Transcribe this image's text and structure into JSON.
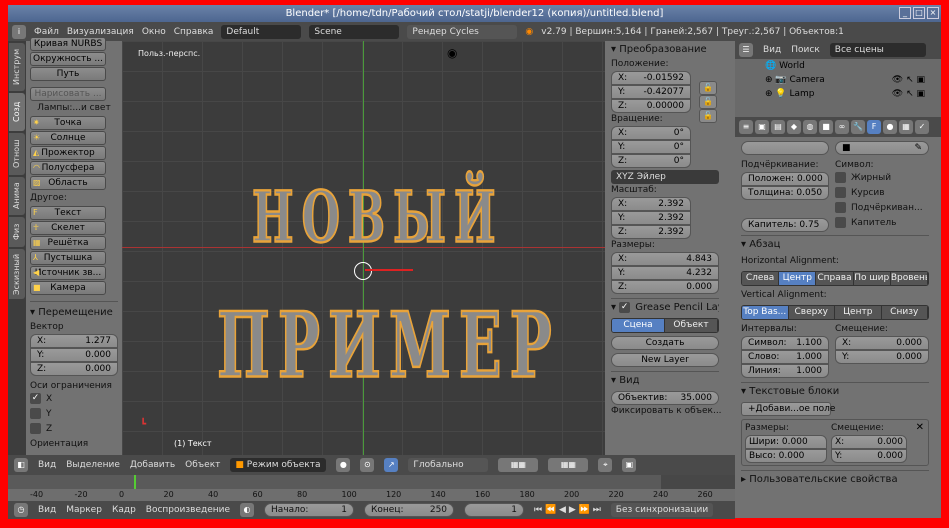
{
  "window": {
    "title": "Blender* [/home/tdn/Рабочий стол/statji/blender12 (копия)/untitled.blend]"
  },
  "menubar": {
    "items": [
      "Файл",
      "Визуализация",
      "Окно",
      "Справка"
    ],
    "layout": "Default",
    "scene": "Scene",
    "engine": "Рендер Cycles",
    "stats": "v2.79 | Вершин:5,164 | Граней:2,567 | Треуг.:2,567 | Объектов:1"
  },
  "tooltabs": [
    "Инструм",
    "Созд",
    "Отнош",
    "Анима",
    "Физ",
    "Эскизный ка"
  ],
  "toolshelf": {
    "curve_items": [
      "Кривая NURBS",
      "Окружность ...",
      "Путь"
    ],
    "draw": "Нарисовать ...",
    "lamps_label": "Лампы:...и свет",
    "lamps": [
      "Точка",
      "Солнце",
      "Прожектор",
      "Полусфера",
      "Область"
    ],
    "other_label": "Другое:",
    "other": [
      "Текст",
      "Скелет",
      "Решётка",
      "Пустышка",
      "Источник зв...",
      "Камера"
    ]
  },
  "operator": {
    "title": "Перемещение",
    "vector_label": "Вектор",
    "vector": [
      {
        "axis": "X:",
        "value": "1.277"
      },
      {
        "axis": "Y:",
        "value": "0.000"
      },
      {
        "axis": "Z:",
        "value": "0.000"
      }
    ],
    "constraint_label": "Оси ограничения",
    "constraints": [
      {
        "label": "X",
        "checked": true
      },
      {
        "label": "Y",
        "checked": false
      },
      {
        "label": "Z",
        "checked": false
      }
    ],
    "orientation_label": "Ориентация"
  },
  "viewport": {
    "view_label": "Польз.-перспс.",
    "object_label": "(1) Текст",
    "text_line1": "НОВЫЙ",
    "text_line2": "ПРИМЕР"
  },
  "npanel": {
    "title": "Преобразование",
    "location_label": "Положение:",
    "location": [
      {
        "axis": "X:",
        "value": "-0.01592"
      },
      {
        "axis": "Y:",
        "value": "-0.42077"
      },
      {
        "axis": "Z:",
        "value": "0.00000"
      }
    ],
    "rotation_label": "Вращение:",
    "rotation": [
      {
        "axis": "X:",
        "value": "0°"
      },
      {
        "axis": "Y:",
        "value": "0°"
      },
      {
        "axis": "Z:",
        "value": "0°"
      }
    ],
    "rotation_mode": "XYZ Эйлер",
    "scale_label": "Масштаб:",
    "scale": [
      {
        "axis": "X:",
        "value": "2.392"
      },
      {
        "axis": "Y:",
        "value": "2.392"
      },
      {
        "axis": "Z:",
        "value": "2.392"
      }
    ],
    "dims_label": "Размеры:",
    "dims": [
      {
        "axis": "X:",
        "value": "4.843"
      },
      {
        "axis": "Y:",
        "value": "4.232"
      },
      {
        "axis": "Z:",
        "value": "0.000"
      }
    ],
    "grease_title": "Grease Pencil Laye",
    "gp_scene": "Сцена",
    "gp_object": "Объект",
    "gp_create": "Создать",
    "gp_new_layer": "New Layer",
    "view_title": "Вид",
    "lens_label": "Объектив:",
    "lens_value": "35.000",
    "lock_label": "Фиксировать к объек..."
  },
  "outliner": {
    "view": "Вид",
    "search": "Поиск",
    "filter": "Все сцены",
    "items": [
      "World",
      "Camera",
      "Lamp"
    ]
  },
  "props": {
    "underline_label": "Подчёркивание:",
    "underline_pos": "Положен: 0.000",
    "underline_thick": "Толщина: 0.050",
    "smallcaps": "Капитель:  0.75",
    "char_label": "Символ:",
    "char_opts": [
      "Жирный",
      "Курсив",
      "Подчёркиван...",
      "Капитель"
    ],
    "para_title": "Абзац",
    "halign_label": "Horizontal Alignment:",
    "halign": [
      "Слева",
      "Центр",
      "Справа",
      "По шир",
      "Вровень"
    ],
    "valign_label": "Vertical Alignment:",
    "valign": [
      "Top Bas...",
      "Сверху",
      "Центр",
      "Снизу"
    ],
    "spacing_label": "Интервалы:",
    "spacing": [
      {
        "k": "Символ:",
        "v": "1.100"
      },
      {
        "k": "Слово:",
        "v": "1.000"
      },
      {
        "k": "Линия:",
        "v": "1.000"
      }
    ],
    "offset_label": "Смещение:",
    "offset": [
      {
        "k": "X:",
        "v": "0.000"
      },
      {
        "k": "Y:",
        "v": "0.000"
      }
    ],
    "textbox_title": "Текстовые блоки",
    "add_textbox": "Добави...ое поле",
    "tb_size_label": "Размеры:",
    "tb_width": "Шири: 0.000",
    "tb_height": "Высо: 0.000",
    "tb_offset_label": "Смещение:",
    "tb_offset": [
      {
        "k": "X:",
        "v": "0.000"
      },
      {
        "k": "Y:",
        "v": "0.000"
      }
    ],
    "custom_title": "Пользовательские свойства"
  },
  "vphead": {
    "items": [
      "Вид",
      "Выделение",
      "Добавить",
      "Объект"
    ],
    "mode": "Режим объекта",
    "orientation": "Глобально"
  },
  "timeline": {
    "ticks": [
      "-40",
      "-20",
      "0",
      "20",
      "40",
      "60",
      "80",
      "100",
      "120",
      "140",
      "160",
      "180",
      "200",
      "220",
      "240",
      "260"
    ],
    "items": [
      "Вид",
      "Маркер",
      "Кадр",
      "Воспроизведение"
    ],
    "start_label": "Начало:",
    "start": "1",
    "end_label": "Конец:",
    "end": "250",
    "current": "1",
    "sync": "Без синхронизации"
  }
}
